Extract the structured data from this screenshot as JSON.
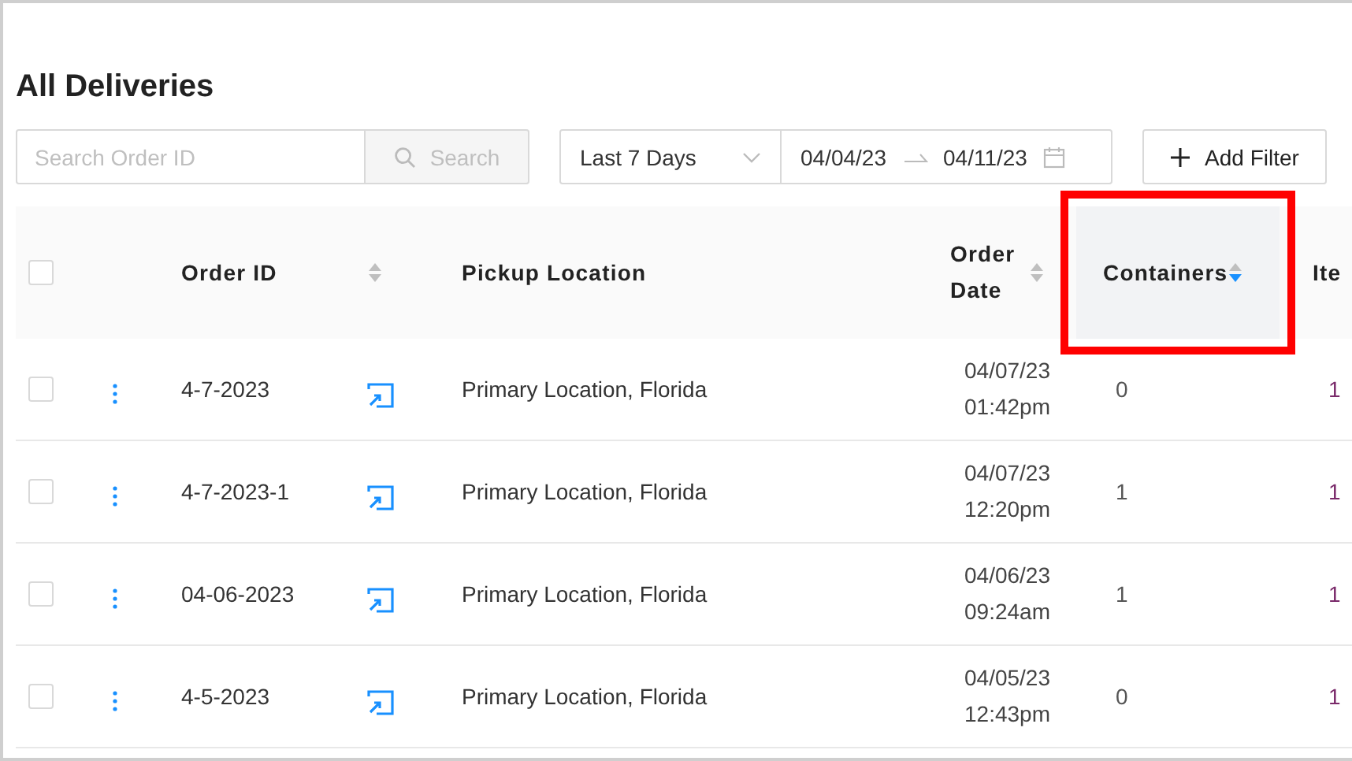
{
  "title": "All Deliveries",
  "filters": {
    "search": {
      "placeholder": "Search Order ID",
      "button": "Search",
      "disabled": true
    },
    "range": {
      "value": "Last 7 Days"
    },
    "dates": {
      "from": "04/04/23",
      "to": "04/11/23"
    },
    "add_filter": "Add Filter"
  },
  "table": {
    "select_all": {
      "checked": false
    },
    "columns": [
      {
        "kind": "order",
        "label": "Order ID",
        "sorted_desc": false
      },
      {
        "kind": "pickup",
        "label": "Pickup Location"
      },
      {
        "kind": "date",
        "label": "Order Date",
        "sorted_desc": false
      },
      {
        "kind": "count",
        "label": "Containers",
        "sorted_desc": true,
        "highlighted": true
      },
      {
        "kind": "items",
        "label": "Ite"
      }
    ],
    "rows": [
      {
        "checked": false,
        "order_id": "4-7-2023",
        "pickup": "Primary Location, Florida",
        "date": "04/07/23",
        "time": "01:42pm",
        "containers": "0",
        "items": "1"
      },
      {
        "checked": false,
        "order_id": "4-7-2023-1",
        "pickup": "Primary Location, Florida",
        "date": "04/07/23",
        "time": "12:20pm",
        "containers": "1",
        "items": "1"
      },
      {
        "checked": false,
        "order_id": "04-06-2023",
        "pickup": "Primary Location, Florida",
        "date": "04/06/23",
        "time": "09:24am",
        "containers": "1",
        "items": "1"
      },
      {
        "checked": false,
        "order_id": "4-5-2023",
        "pickup": "Primary Location, Florida",
        "date": "04/05/23",
        "time": "12:43pm",
        "containers": "0",
        "items": "1"
      }
    ]
  }
}
